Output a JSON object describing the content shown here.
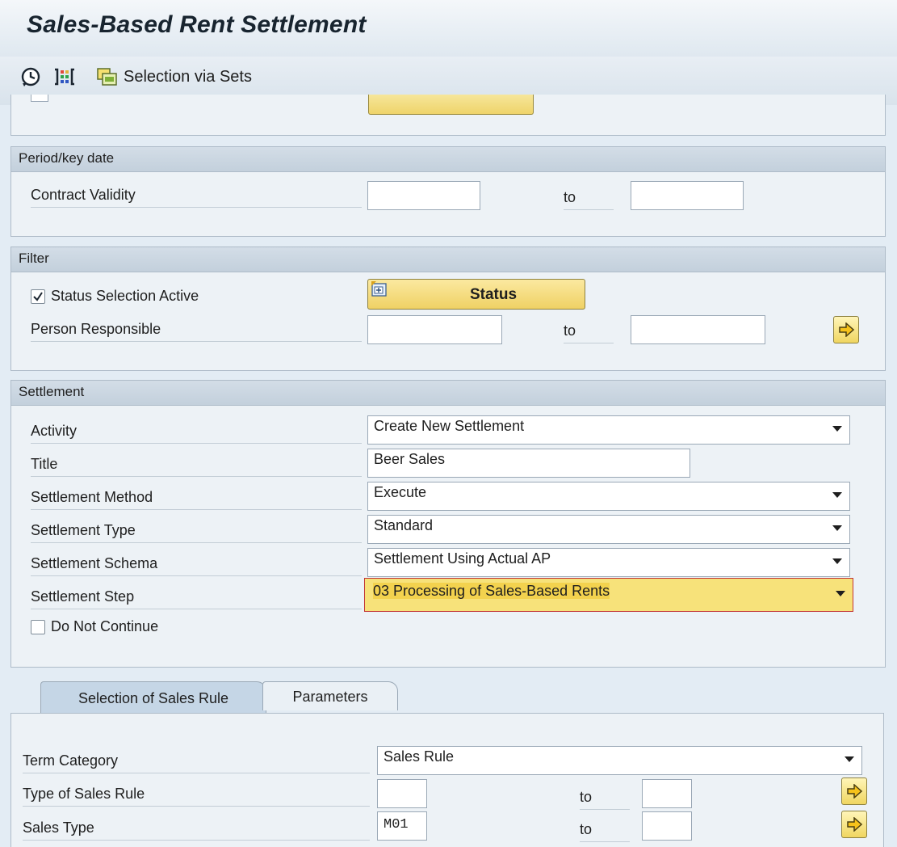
{
  "app": {
    "title": "Sales-Based Rent Settlement"
  },
  "toolbar": {
    "execute_icon": "execute-clock-icon",
    "display_icon": "column-layout-icon",
    "sets_icon": "selection-sets-icon",
    "selection_via_sets_label": "Selection via Sets"
  },
  "period": {
    "header": "Period/key date",
    "contract_validity_label": "Contract Validity",
    "contract_validity_from": "",
    "to_label": "to",
    "contract_validity_to": ""
  },
  "filter": {
    "header": "Filter",
    "status_selection_label": "Status Selection Active",
    "status_selection_checked": true,
    "status_button_label": "Status",
    "person_responsible_label": "Person Responsible",
    "person_responsible_from": "",
    "to_label": "to",
    "person_responsible_to": ""
  },
  "settlement": {
    "header": "Settlement",
    "activity_label": "Activity",
    "activity_value": "Create New Settlement",
    "title_label": "Title",
    "title_value": "Beer Sales",
    "method_label": "Settlement Method",
    "method_value": "Execute",
    "type_label": "Settlement Type",
    "type_value": "Standard",
    "schema_label": "Settlement Schema",
    "schema_value": "Settlement Using Actual AP",
    "step_label": "Settlement Step",
    "step_value": "03 Processing of Sales-Based Rents",
    "do_not_continue_label": "Do Not Continue",
    "do_not_continue_checked": false
  },
  "tabs": [
    {
      "label": "Selection of Sales Rule",
      "active": true
    },
    {
      "label": "Parameters",
      "active": false
    }
  ],
  "sales_rule": {
    "term_category_label": "Term Category",
    "term_category_value": "Sales Rule",
    "type_label": "Type of Sales Rule",
    "type_from": "",
    "type_to": "",
    "sales_type_label": "Sales Type",
    "sales_type_from": "M01",
    "sales_type_to": "",
    "to_label": "to"
  },
  "colors": {
    "background": "#e3ecf4",
    "frame_header": "#c3d0dc",
    "button_yellow": "#f0d660",
    "highlight_yellow": "#f7e27a"
  }
}
